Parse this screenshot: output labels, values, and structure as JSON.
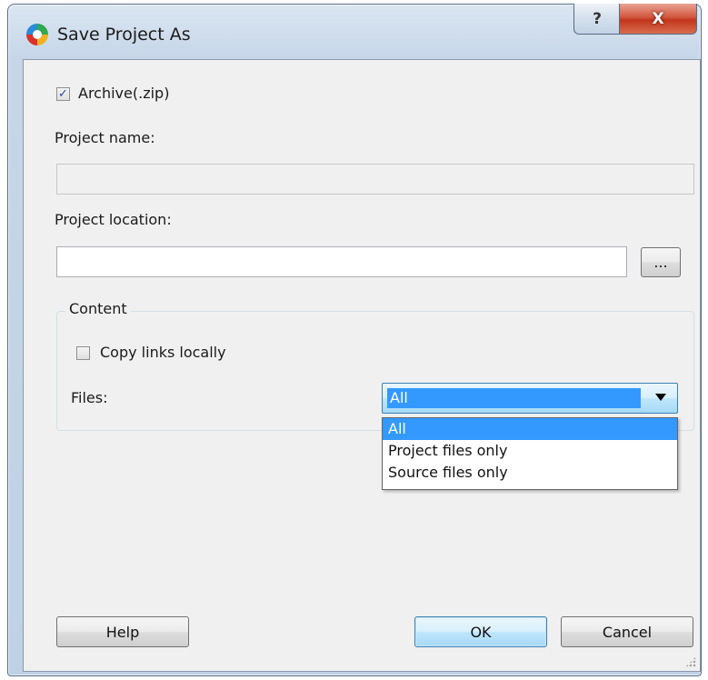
{
  "window": {
    "title": "Save Project As",
    "help_glyph": "?",
    "close_glyph": "X"
  },
  "archive": {
    "label": "Archive(.zip)",
    "checked": true,
    "check_glyph": "✓"
  },
  "project_name": {
    "label": "Project name:",
    "value": ""
  },
  "project_location": {
    "label": "Project location:",
    "value": "",
    "browse_label": "..."
  },
  "content": {
    "title": "Content",
    "copy_links": {
      "label": "Copy links locally",
      "checked": false
    },
    "files": {
      "label": "Files:",
      "selected": "All",
      "options": [
        "All",
        "Project files only",
        "Source files only"
      ]
    }
  },
  "buttons": {
    "help": "Help",
    "ok": "OK",
    "cancel": "Cancel"
  },
  "colors": {
    "selection": "#3399ff",
    "close_button": "#c2361c",
    "default_button_border": "#3c7fb1"
  },
  "icons": {
    "app": "app-logo-icon",
    "combo": "chevron-down-icon",
    "grip": "resize-grip-icon"
  }
}
